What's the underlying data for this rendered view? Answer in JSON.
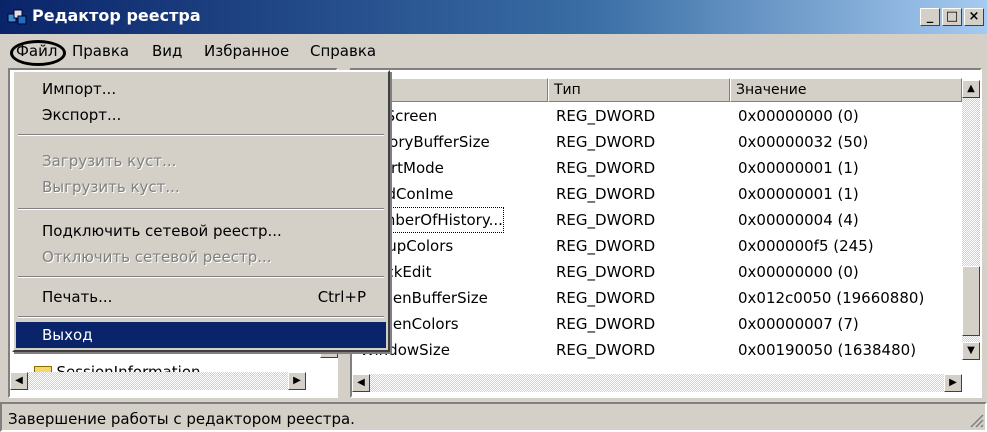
{
  "window": {
    "title": "Редактор реестра",
    "app_icon": "regedit-icon",
    "controls": {
      "minimize": "_",
      "maximize": "□",
      "close": "×"
    }
  },
  "menubar": {
    "items": [
      {
        "label": "Файл"
      },
      {
        "label": "Правка"
      },
      {
        "label": "Вид"
      },
      {
        "label": "Избранное"
      },
      {
        "label": "Справка"
      }
    ]
  },
  "file_menu": {
    "items": [
      {
        "label": "Импорт..."
      },
      {
        "label": "Экспорт..."
      },
      {
        "label": "Загрузить куст..."
      },
      {
        "label": "Выгрузить куст..."
      },
      {
        "label": "Подключить сетевой реестр..."
      },
      {
        "label": "Отключить сетевой реестр..."
      },
      {
        "label": "Печать...",
        "shortcut": "Ctrl+P"
      },
      {
        "label": "Выход"
      }
    ]
  },
  "tree": {
    "partial_item": "SessionInformation"
  },
  "list": {
    "columns": {
      "name": "",
      "type": "Тип",
      "value": "Значение"
    },
    "rows": [
      {
        "name": "FullScreen",
        "type": "REG_DWORD",
        "value": "0x00000000 (0)"
      },
      {
        "name": "HistoryBufferSize",
        "type": "REG_DWORD",
        "value": "0x00000032 (50)"
      },
      {
        "name": "InsertMode",
        "type": "REG_DWORD",
        "value": "0x00000001 (1)"
      },
      {
        "name": "LoadConIme",
        "type": "REG_DWORD",
        "value": "0x00000001 (1)"
      },
      {
        "name": "NumberOfHistory...",
        "type": "REG_DWORD",
        "value": "0x00000004 (4)"
      },
      {
        "name": "PopupColors",
        "type": "REG_DWORD",
        "value": "0x000000f5 (245)"
      },
      {
        "name": "QuickEdit",
        "type": "REG_DWORD",
        "value": "0x00000000 (0)"
      },
      {
        "name": "ScreenBufferSize",
        "type": "REG_DWORD",
        "value": "0x012c0050 (19660880)"
      },
      {
        "name": "ScreenColors",
        "type": "REG_DWORD",
        "value": "0x00000007 (7)"
      },
      {
        "name": "WindowSize",
        "type": "REG_DWORD",
        "value": "0x00190050 (1638480)"
      }
    ]
  },
  "statusbar": {
    "text": "Завершение работы с редактором реестра."
  },
  "colors": {
    "title_bar": "#0a246a",
    "selection": "#0a246a",
    "face": "#d4d0c8"
  }
}
